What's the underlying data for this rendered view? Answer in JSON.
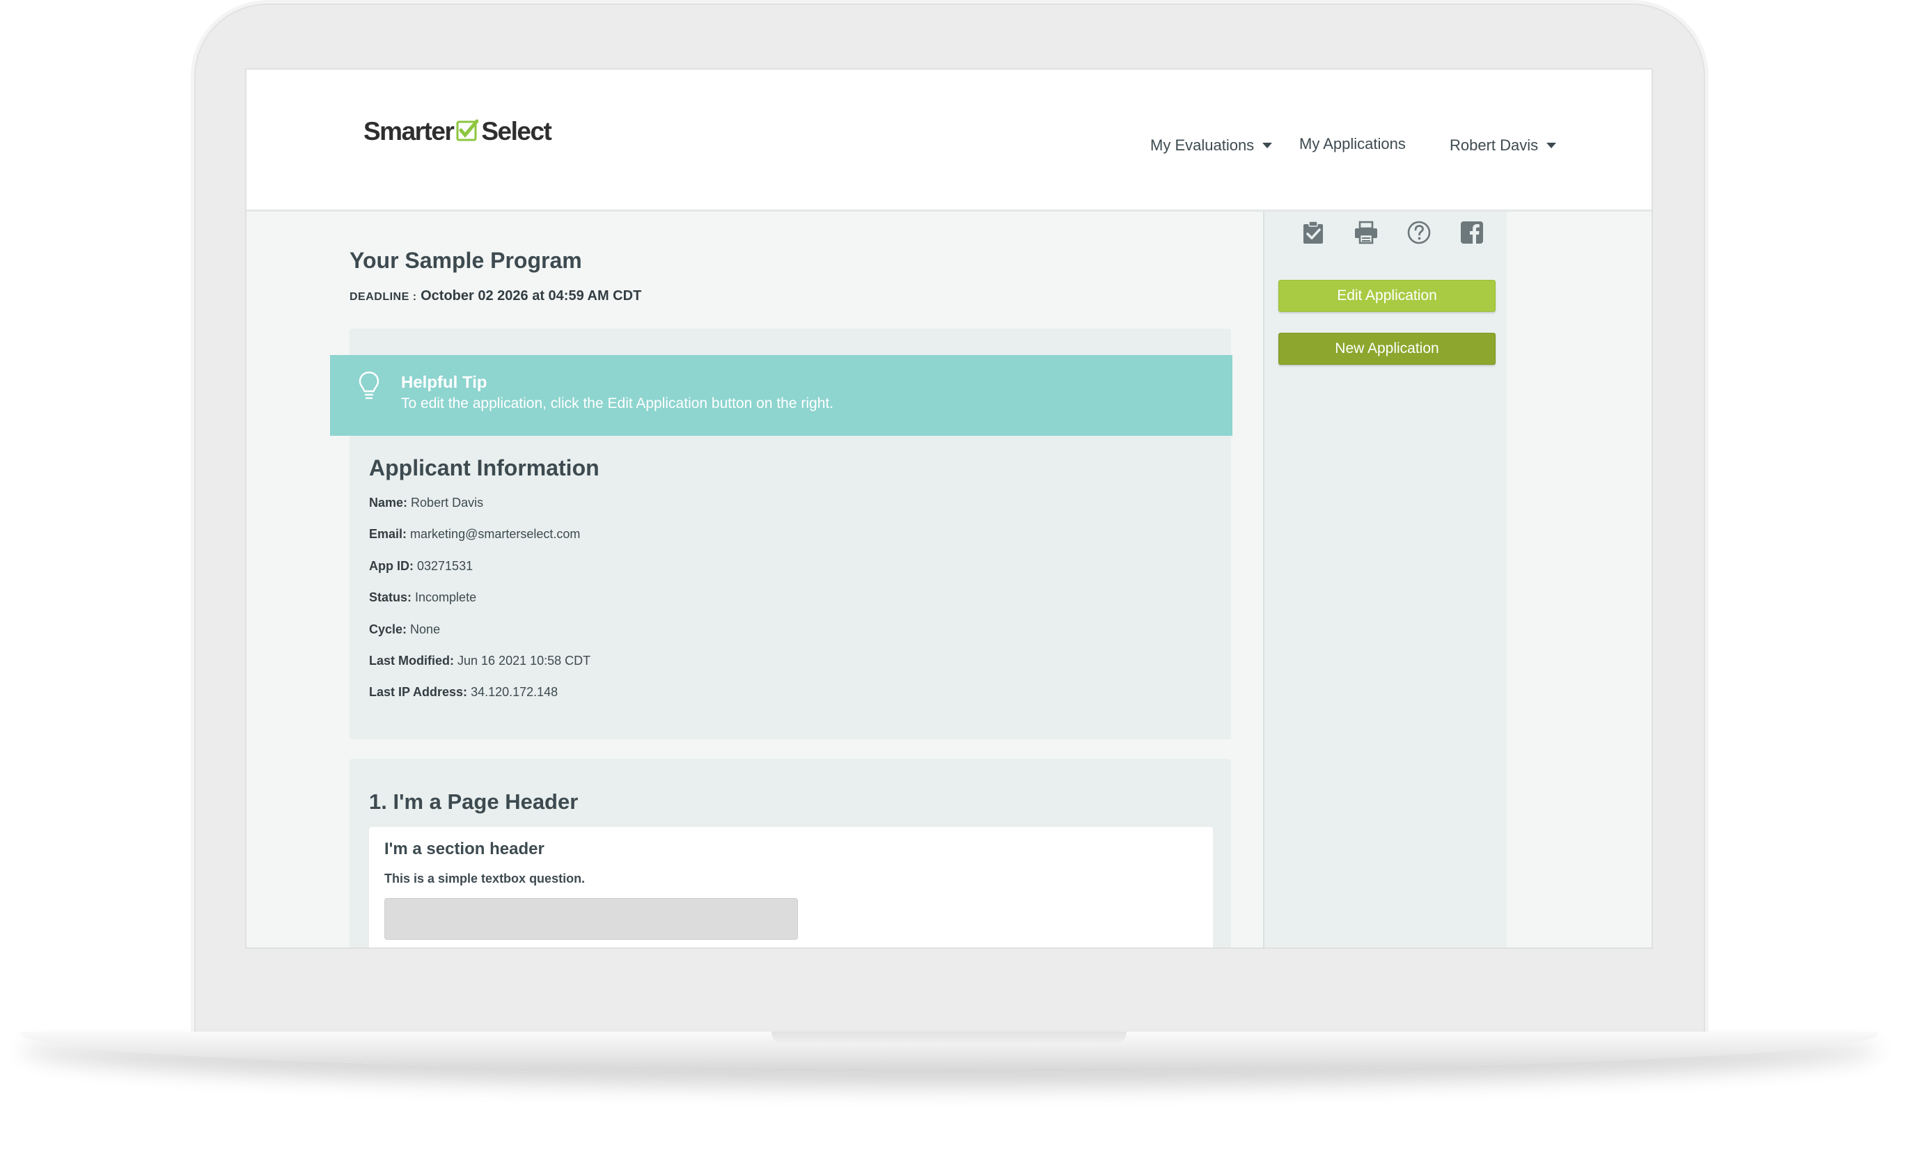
{
  "brand": {
    "name_left": "Smarter",
    "name_right": "Select",
    "check_color": "#8dc63f"
  },
  "nav": {
    "evaluations": "My Evaluations",
    "applications": "My Applications",
    "user": "Robert Davis"
  },
  "program": {
    "title": "Your Sample Program",
    "deadline_label": "DEADLINE :",
    "deadline_value": "October 02 2026 at 04:59 AM CDT"
  },
  "tip": {
    "title": "Helpful Tip",
    "text": "To edit the application, click the Edit Application button on the right."
  },
  "applicant": {
    "title": "Applicant Information",
    "fields": [
      {
        "label": "Name:",
        "value": "Robert Davis"
      },
      {
        "label": "Email:",
        "value": "marketing@smarterselect.com"
      },
      {
        "label": "App ID:",
        "value": "03271531"
      },
      {
        "label": "Status:",
        "value": "Incomplete"
      },
      {
        "label": "Cycle:",
        "value": "None"
      },
      {
        "label": "Last Modified:",
        "value": "Jun 16 2021 10:58 CDT"
      },
      {
        "label": "Last IP Address:",
        "value": "34.120.172.148"
      }
    ]
  },
  "page": {
    "header": "1. I'm a Page Header",
    "section_header": "I'm a section header",
    "question": "This is a simple textbox question."
  },
  "sidebar": {
    "icons": [
      "clipboard-check-icon",
      "printer-icon",
      "help-circle-icon",
      "facebook-icon"
    ],
    "edit_label": "Edit Application",
    "new_label": "New Application"
  },
  "colors": {
    "tip_bg": "#8ed4cf",
    "edit_btn": "#a9cb44",
    "new_btn": "#8da62d",
    "text": "#3d4a50"
  }
}
